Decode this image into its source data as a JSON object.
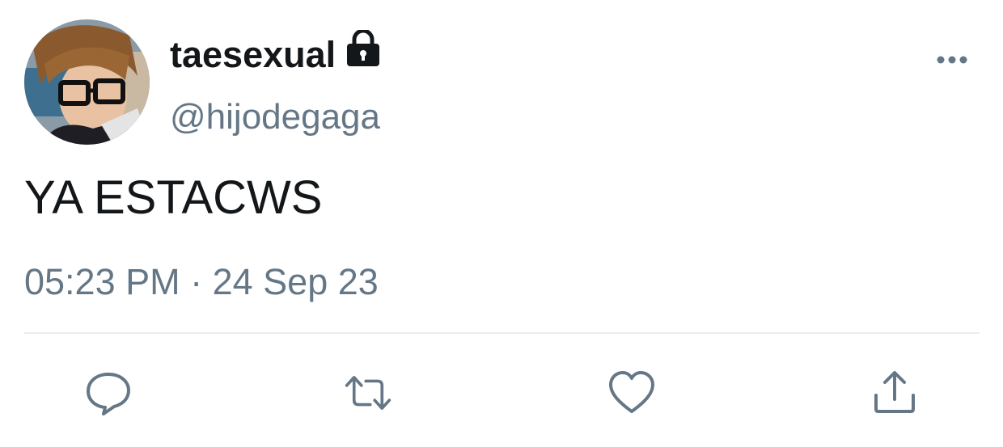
{
  "tweet": {
    "author": {
      "display_name": "taesexual",
      "handle": "@hijodegaga",
      "protected_icon": "lock-icon",
      "avatar": "profile-photo"
    },
    "text": "YA ESTACWS",
    "timestamp": "05:23 PM · 24 Sep 23",
    "more_icon": "more-horizontal-icon",
    "actions": [
      {
        "name": "reply",
        "icon": "reply-icon"
      },
      {
        "name": "retweet",
        "icon": "retweet-icon"
      },
      {
        "name": "like",
        "icon": "heart-icon"
      },
      {
        "name": "share",
        "icon": "share-icon"
      }
    ]
  },
  "colors": {
    "text_primary": "#14171a",
    "text_secondary": "#657786",
    "divider": "#e6ecf0",
    "icon": "#657786"
  }
}
